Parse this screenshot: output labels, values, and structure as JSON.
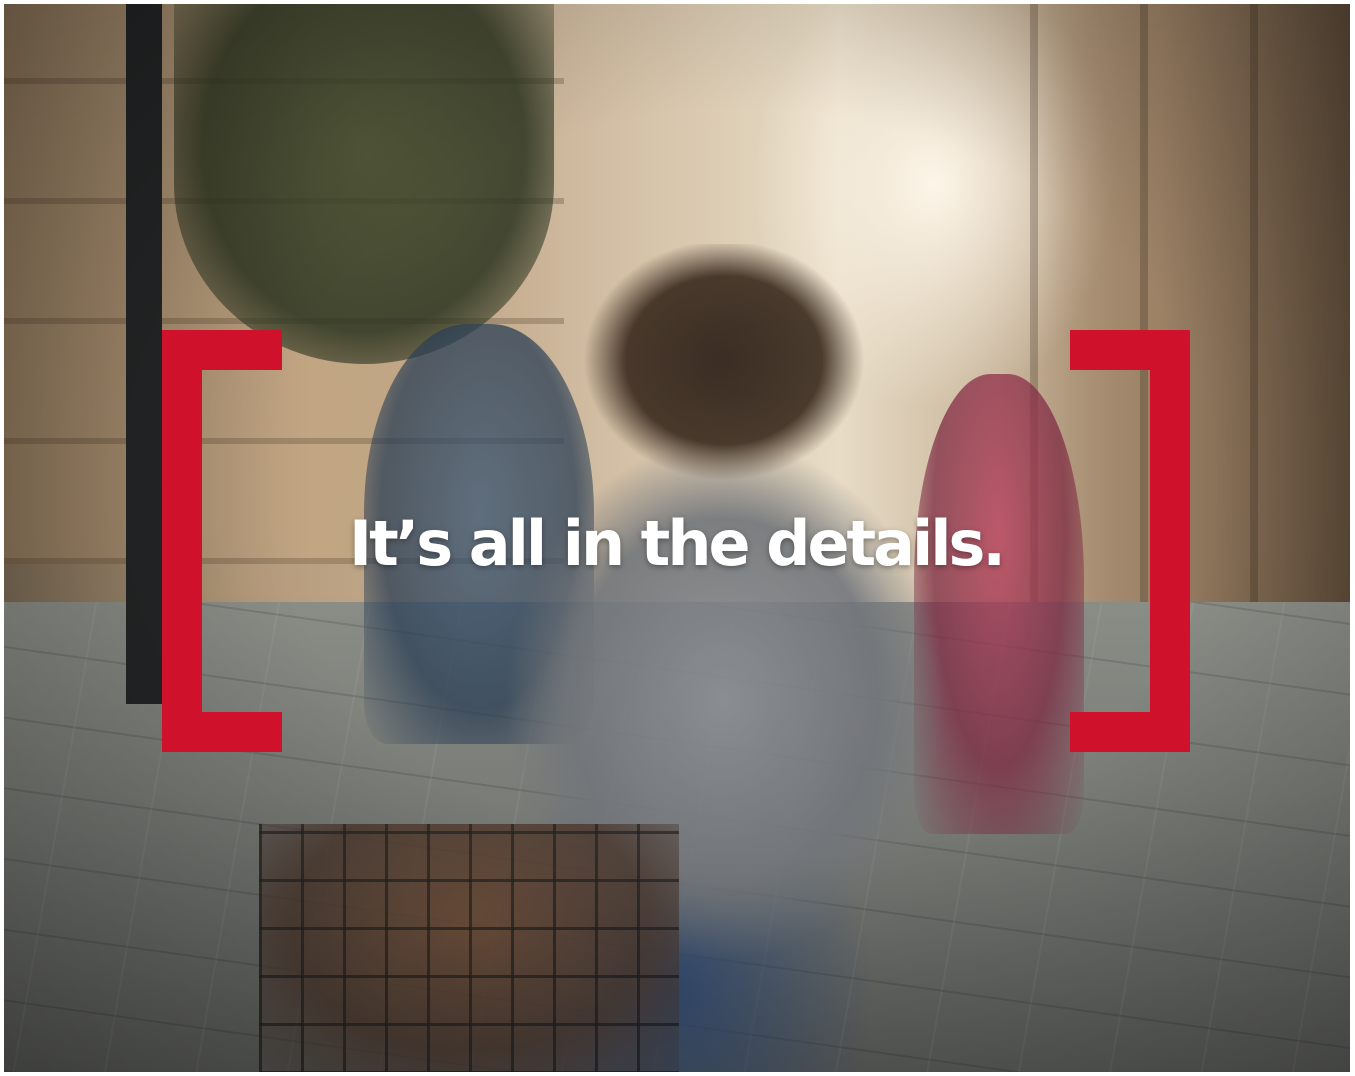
{
  "headline": "It’s all in the details.",
  "colors": {
    "bracket": "#d0112b",
    "headline": "#ffffff"
  }
}
